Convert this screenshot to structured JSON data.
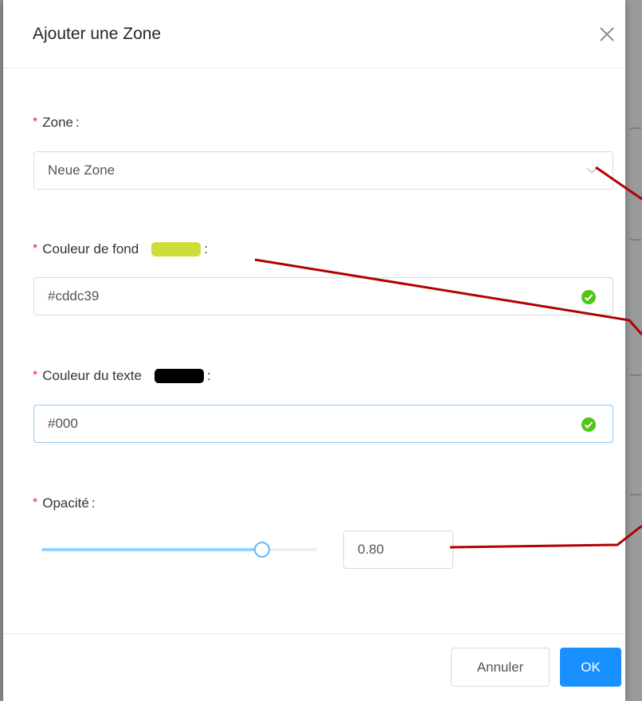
{
  "modal": {
    "title": "Ajouter une Zone",
    "close_icon": "close-icon"
  },
  "form": {
    "zone": {
      "label": "Zone",
      "colon": ":",
      "value": "Neue Zone",
      "icon": "chevron-down-icon"
    },
    "background_color": {
      "label": "Couleur de fond",
      "colon": ":",
      "value": "#cddc39",
      "swatch_color": "#cddc39",
      "status_icon": "check-circle-icon"
    },
    "text_color": {
      "label": "Couleur du texte",
      "colon": ":",
      "value": "#000",
      "swatch_color": "#000000",
      "status_icon": "check-circle-icon"
    },
    "opacity": {
      "label": "Opacité",
      "colon": ":",
      "value": "0.80",
      "slider_fraction": 0.8
    },
    "required_marker": "*"
  },
  "footer": {
    "cancel_label": "Annuler",
    "ok_label": "OK"
  },
  "colors": {
    "primary": "#1890ff",
    "success": "#52c41a",
    "required": "#f5222d",
    "annotation": "#b30000"
  }
}
